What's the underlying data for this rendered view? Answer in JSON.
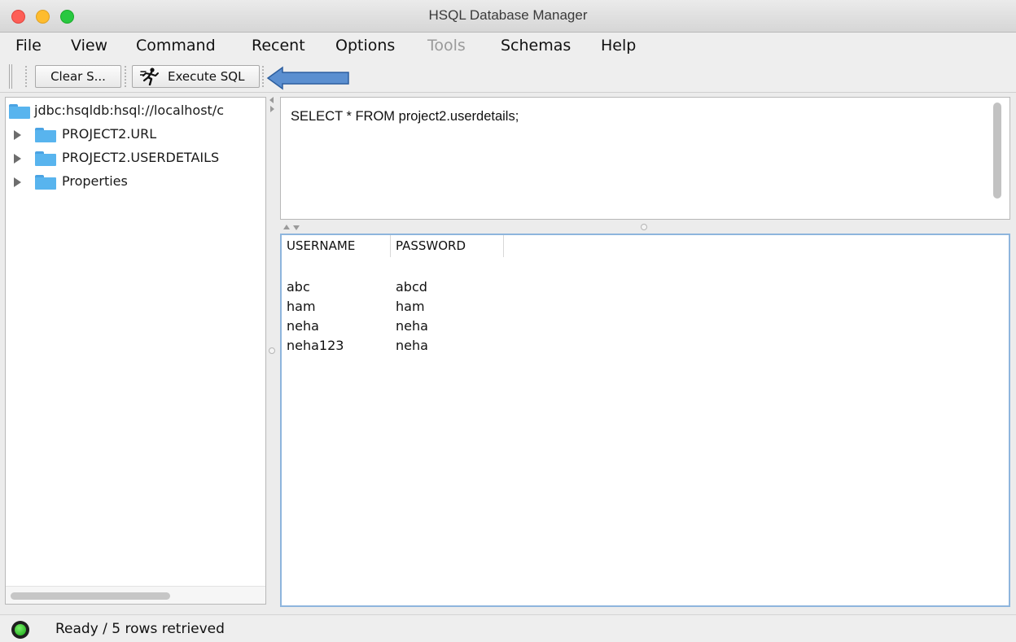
{
  "window": {
    "title": "HSQL Database Manager"
  },
  "menu": {
    "items": [
      "File",
      "View",
      "Command",
      "Recent",
      "Options",
      "Tools",
      "Schemas",
      "Help"
    ],
    "disabled": [
      "Tools"
    ]
  },
  "toolbar": {
    "clear_label": "Clear S...",
    "execute_label": "Execute SQL",
    "execute_icon": "runner-icon",
    "annotation": "blue-arrow-icon"
  },
  "tree": {
    "root": "jdbc:hsqldb:hsql://localhost/c",
    "items": [
      "PROJECT2.URL",
      "PROJECT2.USERDETAILS",
      "Properties"
    ]
  },
  "editor": {
    "sql": "SELECT * FROM project2.userdetails;"
  },
  "results": {
    "columns": [
      "USERNAME",
      "PASSWORD"
    ],
    "rows": [
      [
        "abc",
        "abcd"
      ],
      [
        "ham",
        "ham"
      ],
      [
        "neha",
        "neha"
      ],
      [
        "neha123",
        "neha"
      ]
    ]
  },
  "status": {
    "text": "Ready / 5 rows retrieved",
    "indicator_color": "#2ecc2e"
  },
  "colors": {
    "folder": "#58b4ee",
    "arrow": "#5b8fd0",
    "results_border": "#8eb5dd"
  }
}
